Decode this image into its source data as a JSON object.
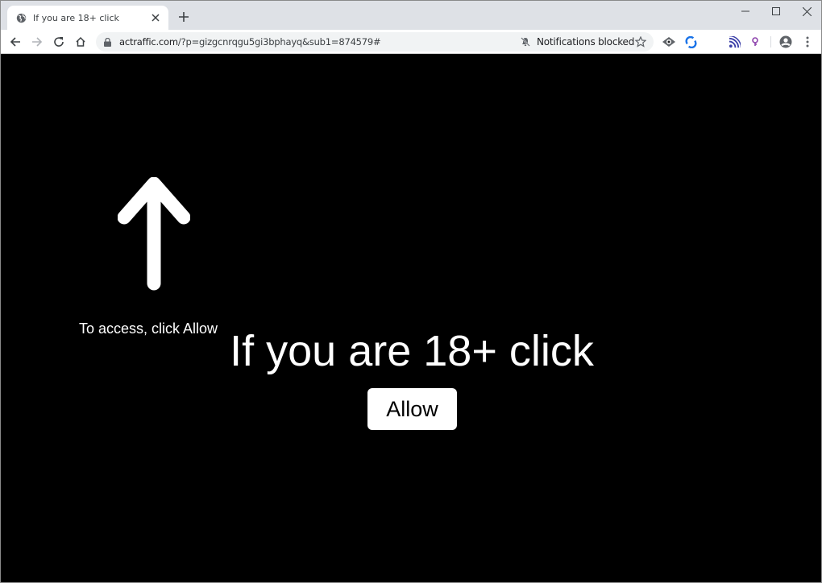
{
  "browser": {
    "tab": {
      "title": "If you are 18+ click",
      "favicon": "globe-icon",
      "close_glyph": "✕"
    },
    "new_tab_glyph": "+",
    "window_controls": {
      "minimize": "minimize-icon",
      "maximize": "maximize-icon",
      "close": "close-icon"
    },
    "nav": {
      "back": "back-arrow-icon",
      "forward": "forward-arrow-icon",
      "reload": "reload-icon",
      "home": "home-icon"
    },
    "address_bar": {
      "host": "actraffic.com",
      "path": "/?p=gizgcnrqgu5gi3bphayq&sub1=874579#",
      "security_icon": "lock-icon"
    },
    "notifications_chip": {
      "label": "Notifications blocked",
      "icon": "bell-off-icon"
    },
    "bookmark_icon": "star-icon",
    "extensions": [
      {
        "name": "eye-extension-icon",
        "color": "#3c4043"
      },
      {
        "name": "sync-extension-icon",
        "color": "#1a73e8"
      },
      {
        "name": "rss-extension-icon",
        "color": "#3b3fa8"
      },
      {
        "name": "search-extension-icon",
        "color": "#8e44ad"
      }
    ],
    "profile_icon": "account-circle-icon",
    "menu_icon": "more-vert-icon"
  },
  "page": {
    "hint_text": "To access, click Allow",
    "headline": "If you are 18+ click",
    "allow_button_label": "Allow",
    "arrow_icon": "up-arrow-icon",
    "background_color": "#000000",
    "text_color": "#ffffff"
  }
}
